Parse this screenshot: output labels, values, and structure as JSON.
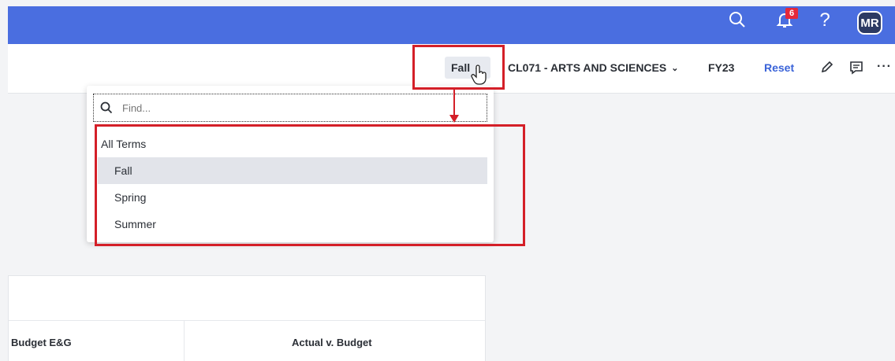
{
  "header": {
    "notification_count": "6",
    "help_label": "?",
    "avatar_initials": "MR",
    "brand_color": "#4a6ee0"
  },
  "toolbar": {
    "term_selected": "Fall",
    "org_label": "CL071 - ARTS AND SCIENCES",
    "fiscal_year": "FY23",
    "reset_label": "Reset",
    "more_label": "···"
  },
  "dropdown": {
    "search_placeholder": "Find...",
    "options": [
      {
        "label": "All Terms",
        "selected": false
      },
      {
        "label": "Fall",
        "selected": true
      },
      {
        "label": "Spring",
        "selected": false
      },
      {
        "label": "Summer",
        "selected": false
      }
    ]
  },
  "table": {
    "col_budget": "Budget E&G",
    "col_actual": "Actual v. Budget"
  },
  "annotation_color": "#d41f28"
}
